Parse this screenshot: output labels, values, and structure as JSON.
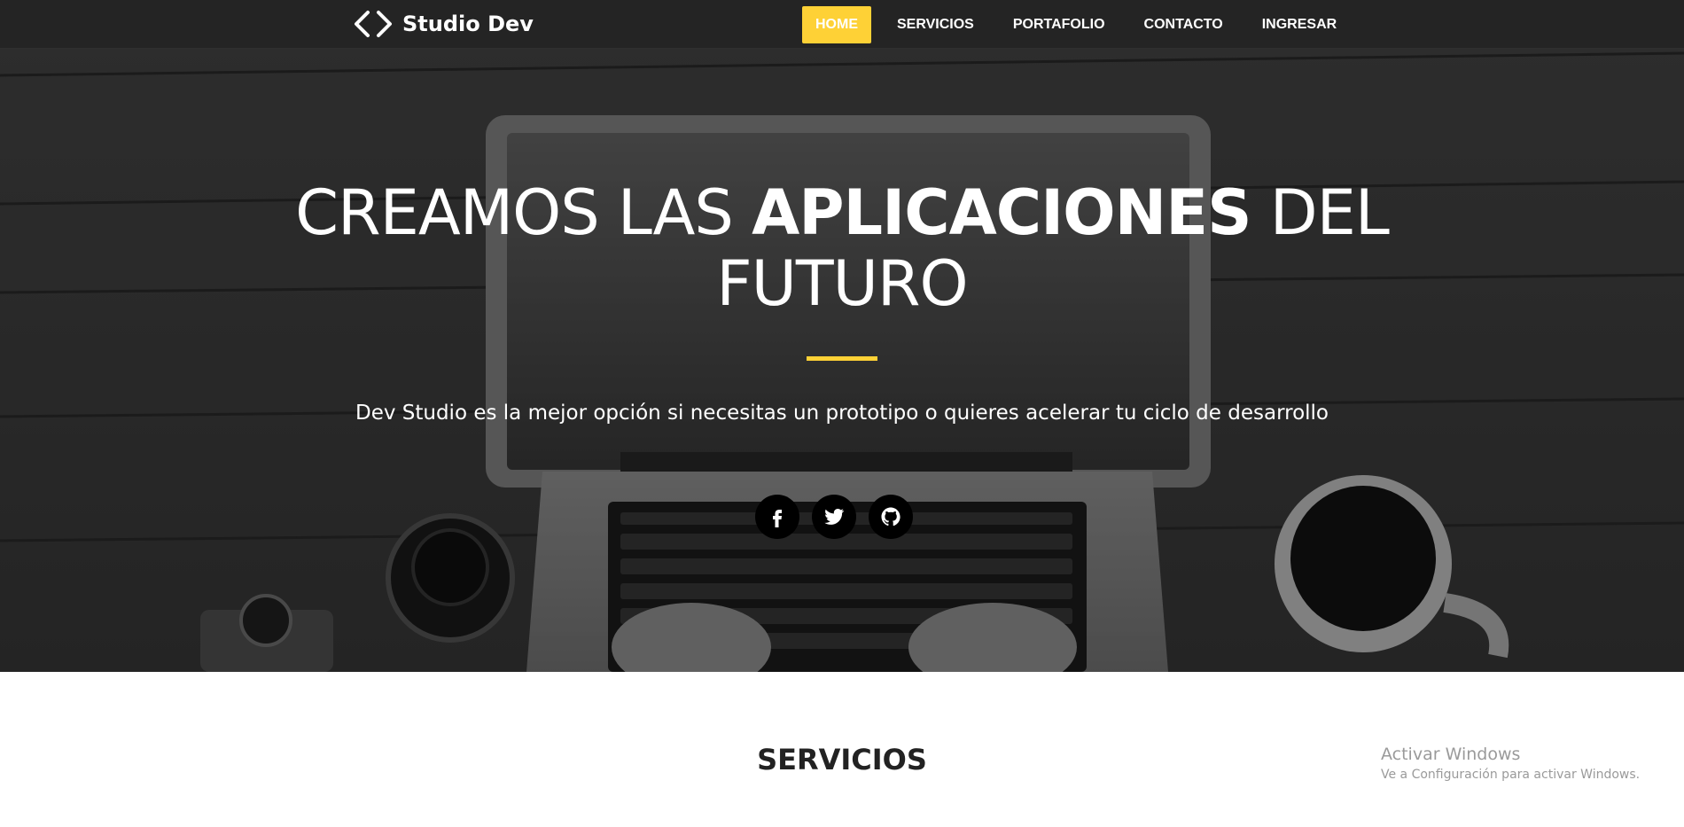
{
  "brand": {
    "name": "Studio Dev",
    "icon": "code-brackets-icon"
  },
  "nav": {
    "items": [
      {
        "label": "HOME",
        "active": true
      },
      {
        "label": "SERVICIOS",
        "active": false
      },
      {
        "label": "PORTAFOLIO",
        "active": false
      },
      {
        "label": "CONTACTO",
        "active": false
      },
      {
        "label": "INGRESAR",
        "active": false
      }
    ]
  },
  "hero": {
    "title_prefix": "CREAMOS LAS",
    "title_strong": "APLICACIONES",
    "title_suffix": "DEL",
    "title_line2": "FUTURO",
    "subtitle": "Dev Studio es la mejor opción si necesitas un prototipo o quieres acelerar tu ciclo de desarrollo",
    "social": [
      "facebook-icon",
      "twitter-icon",
      "github-icon"
    ]
  },
  "services": {
    "title": "SERVICIOS"
  },
  "watermark": {
    "title": "Activar Windows",
    "subtitle": "Ve a Configuración para activar Windows."
  },
  "colors": {
    "accent": "#fed136",
    "nav_text": "#ffffff",
    "social_bg": "#000000"
  }
}
